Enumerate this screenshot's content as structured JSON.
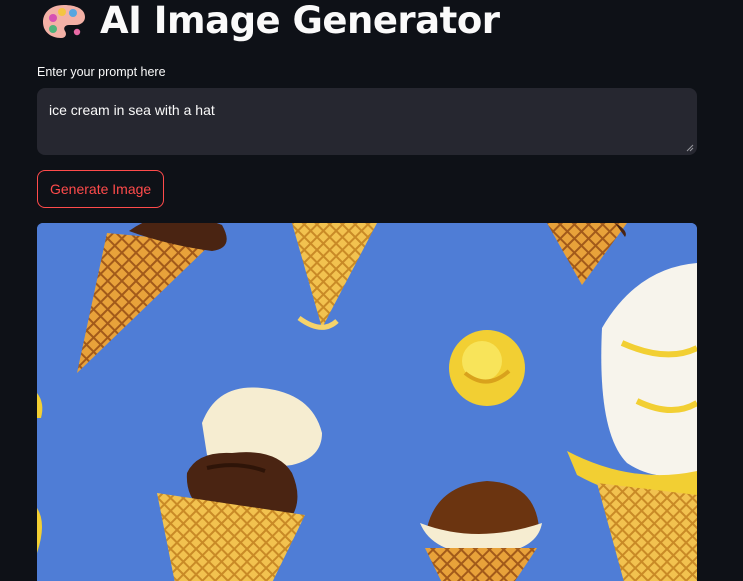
{
  "app": {
    "title": "AI Image Generator",
    "title_icon": "artist-palette-icon"
  },
  "prompt": {
    "label": "Enter your prompt here",
    "value": "ice cream in sea with a hat"
  },
  "generate_button": {
    "label": "Generate Image"
  },
  "generated_image": {
    "description_icon": "generated-image",
    "background_color": "#4f7dd6"
  },
  "colors": {
    "background": "#0e1117",
    "input_background": "#262730",
    "accent": "#ff4b4b",
    "text": "#fafafa"
  }
}
